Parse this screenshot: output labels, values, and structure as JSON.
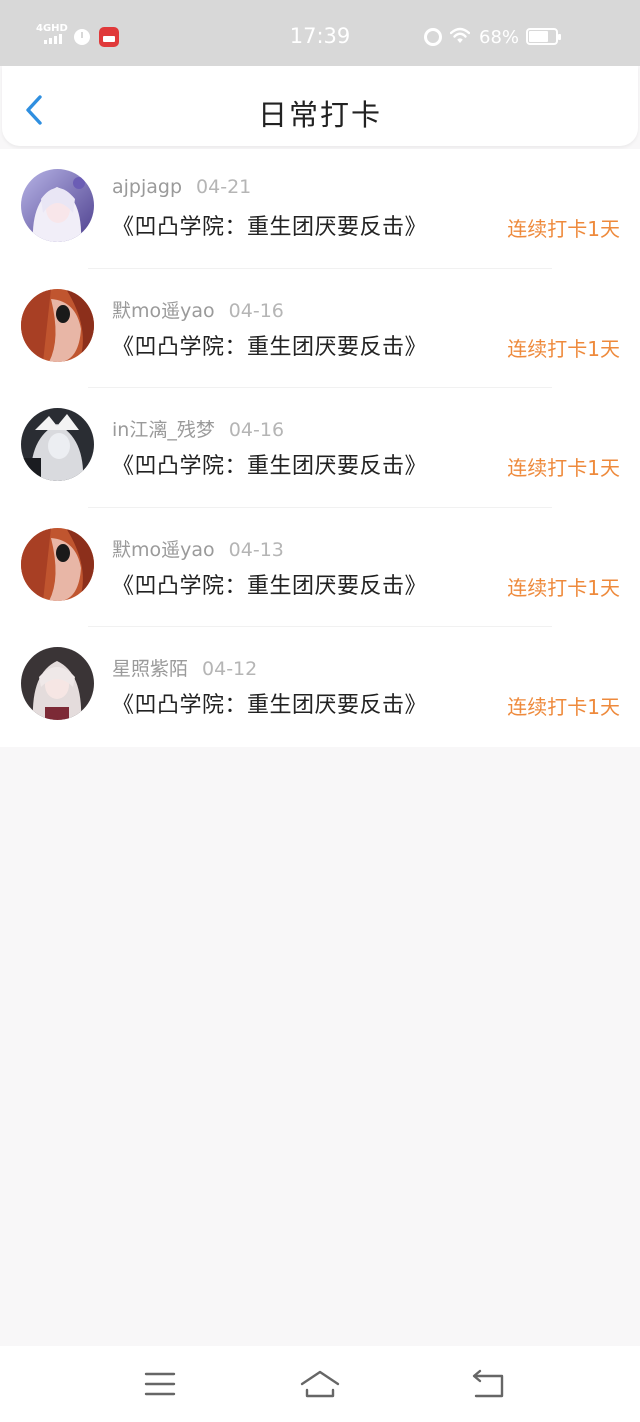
{
  "status_bar": {
    "network": "4GHD",
    "time": "17:39",
    "battery": "68%"
  },
  "header": {
    "title": "日常打卡"
  },
  "entries": [
    {
      "username": "ajpjagp",
      "date": "04-21",
      "book": "《凹凸学院：重生团厌要反击》",
      "streak": "连续打卡1天"
    },
    {
      "username": "默mo遥yao",
      "date": "04-16",
      "book": "《凹凸学院：重生团厌要反击》",
      "streak": "连续打卡1天"
    },
    {
      "username": "in江漓_残梦",
      "date": "04-16",
      "book": "《凹凸学院：重生团厌要反击》",
      "streak": "连续打卡1天"
    },
    {
      "username": "默mo遥yao",
      "date": "04-13",
      "book": "《凹凸学院：重生团厌要反击》",
      "streak": "连续打卡1天"
    },
    {
      "username": "星照紫陌",
      "date": "04-12",
      "book": "《凹凸学院：重生团厌要反击》",
      "streak": "连续打卡1天"
    }
  ],
  "colors": {
    "accent_blue": "#2f8fe0",
    "streak_orange": "#ee8a3c",
    "status_bar_bg": "#d8d8d8",
    "page_bg": "#f8f7f8"
  },
  "icons": {
    "back": "chevron-left-icon",
    "menu": "menu-icon",
    "home": "home-icon",
    "return": "return-icon"
  }
}
